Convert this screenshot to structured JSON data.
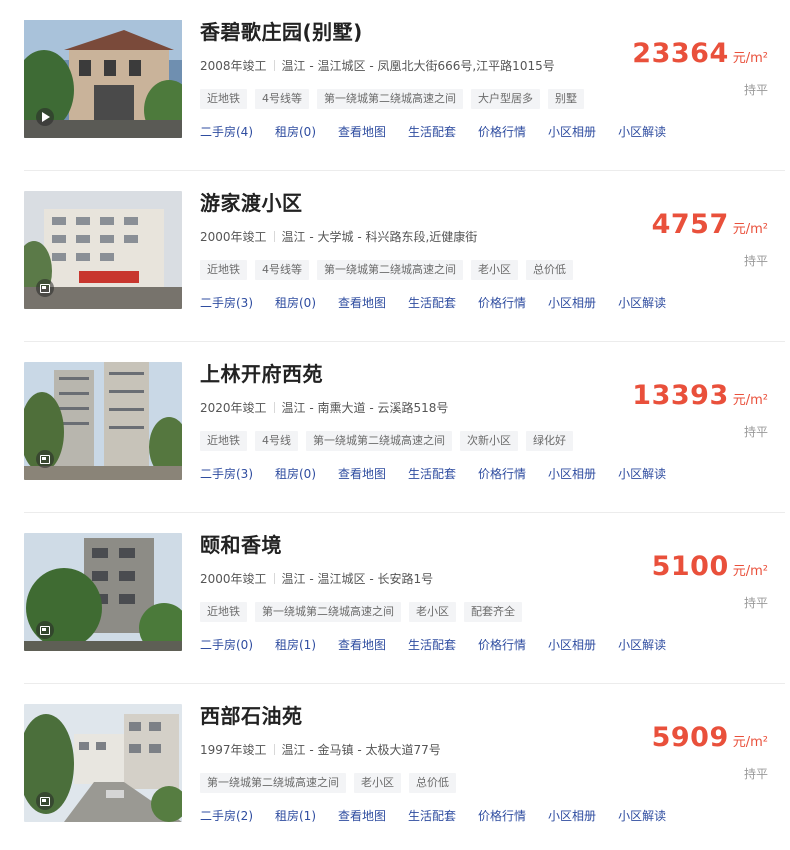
{
  "listings": [
    {
      "title": "香碧歌庄园(别墅)",
      "year": "2008年竣工",
      "location": "温江 - 温江城区 - 凤凰北大街666号,江平路1015号",
      "tags": [
        "近地铁",
        "4号线等",
        "第一绕城第二绕城高速之间",
        "大户型居多",
        "别墅"
      ],
      "links": [
        "二手房(4)",
        "租房(0)",
        "查看地图",
        "生活配套",
        "价格行情",
        "小区相册",
        "小区解读"
      ],
      "price": "23364",
      "unit": "元/m²",
      "trend": "持平",
      "badge": "play-icon"
    },
    {
      "title": "游家渡小区",
      "year": "2000年竣工",
      "location": "温江 - 大学城 - 科兴路东段,近健康街",
      "tags": [
        "近地铁",
        "4号线等",
        "第一绕城第二绕城高速之间",
        "老小区",
        "总价低"
      ],
      "links": [
        "二手房(3)",
        "租房(0)",
        "查看地图",
        "生活配套",
        "价格行情",
        "小区相册",
        "小区解读"
      ],
      "price": "4757",
      "unit": "元/m²",
      "trend": "持平",
      "badge": "album-icon"
    },
    {
      "title": "上林开府西苑",
      "year": "2020年竣工",
      "location": "温江 - 南熏大道 - 云溪路518号",
      "tags": [
        "近地铁",
        "4号线",
        "第一绕城第二绕城高速之间",
        "次新小区",
        "绿化好"
      ],
      "links": [
        "二手房(3)",
        "租房(0)",
        "查看地图",
        "生活配套",
        "价格行情",
        "小区相册",
        "小区解读"
      ],
      "price": "13393",
      "unit": "元/m²",
      "trend": "持平",
      "badge": "album-icon"
    },
    {
      "title": "颐和香境",
      "year": "2000年竣工",
      "location": "温江 - 温江城区 - 长安路1号",
      "tags": [
        "近地铁",
        "第一绕城第二绕城高速之间",
        "老小区",
        "配套齐全"
      ],
      "links": [
        "二手房(0)",
        "租房(1)",
        "查看地图",
        "生活配套",
        "价格行情",
        "小区相册",
        "小区解读"
      ],
      "price": "5100",
      "unit": "元/m²",
      "trend": "持平",
      "badge": "album-icon"
    },
    {
      "title": "西部石油苑",
      "year": "1997年竣工",
      "location": "温江 - 金马镇 - 太极大道77号",
      "tags": [
        "第一绕城第二绕城高速之间",
        "老小区",
        "总价低"
      ],
      "links": [
        "二手房(2)",
        "租房(1)",
        "查看地图",
        "生活配套",
        "价格行情",
        "小区相册",
        "小区解读"
      ],
      "price": "5909",
      "unit": "元/m²",
      "trend": "持平",
      "badge": "album-icon"
    }
  ]
}
